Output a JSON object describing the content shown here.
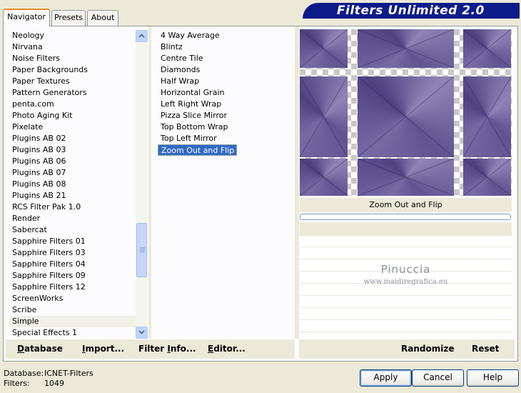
{
  "app": {
    "title": "Filters Unlimited 2.0"
  },
  "tabs": [
    {
      "label": "Navigator"
    },
    {
      "label": "Presets"
    },
    {
      "label": "About"
    }
  ],
  "categories": [
    "Neology",
    "Nirvana",
    "Noise Filters",
    "Paper Backgrounds",
    "Paper Textures",
    "Pattern Generators",
    "penta.com",
    "Photo Aging Kit",
    "Pixelate",
    "Plugins AB 02",
    "Plugins AB 03",
    "Plugins AB 06",
    "Plugins AB 07",
    "Plugins AB 08",
    "Plugins AB 21",
    "RCS Filter Pak 1.0",
    "Render",
    "Sabercat",
    "Sapphire Filters 01",
    "Sapphire Filters 03",
    "Sapphire Filters 04",
    "Sapphire Filters 09",
    "Sapphire Filters 12",
    "ScreenWorks",
    "Scribe",
    "Simple",
    "Special Effects 1"
  ],
  "selected_category": "Simple",
  "filters": [
    "4 Way Average",
    "Blintz",
    "Centre Tile",
    "Diamonds",
    "Half Wrap",
    "Horizontal Grain",
    "Left Right Wrap",
    "Pizza Slice Mirror",
    "Top Bottom Wrap",
    "Top Left Mirror",
    "Zoom Out and Flip"
  ],
  "selected_filter": "Zoom Out and Flip",
  "preview": {
    "caption": "Zoom Out and Flip",
    "tile_colors": [
      "#8f84b6",
      "#5f5391",
      "#766aa5",
      "#4d4180"
    ]
  },
  "watermark": {
    "name": "Pinuccia",
    "site": "www.maidiregrafica.eu"
  },
  "toolbar": {
    "database": {
      "underline": "D",
      "rest": "atabase"
    },
    "import": {
      "underline": "I",
      "rest": "mport..."
    },
    "filter_info": {
      "pre": "Filter ",
      "underline": "I",
      "post": "nfo..."
    },
    "editor": {
      "underline": "E",
      "rest": "ditor..."
    },
    "randomize": "Randomize",
    "reset": "Reset"
  },
  "status": {
    "database_label": "Database:",
    "database_value": "ICNET-Filters",
    "filters_label": "Filters:",
    "filters_value": "1049"
  },
  "buttons": {
    "apply": "Apply",
    "cancel": "Cancel",
    "help": "Help"
  },
  "icons": {
    "scroll_up": "chevron-up-icon",
    "scroll_down": "chevron-down-icon",
    "thumb_grip": "grip-icon"
  }
}
